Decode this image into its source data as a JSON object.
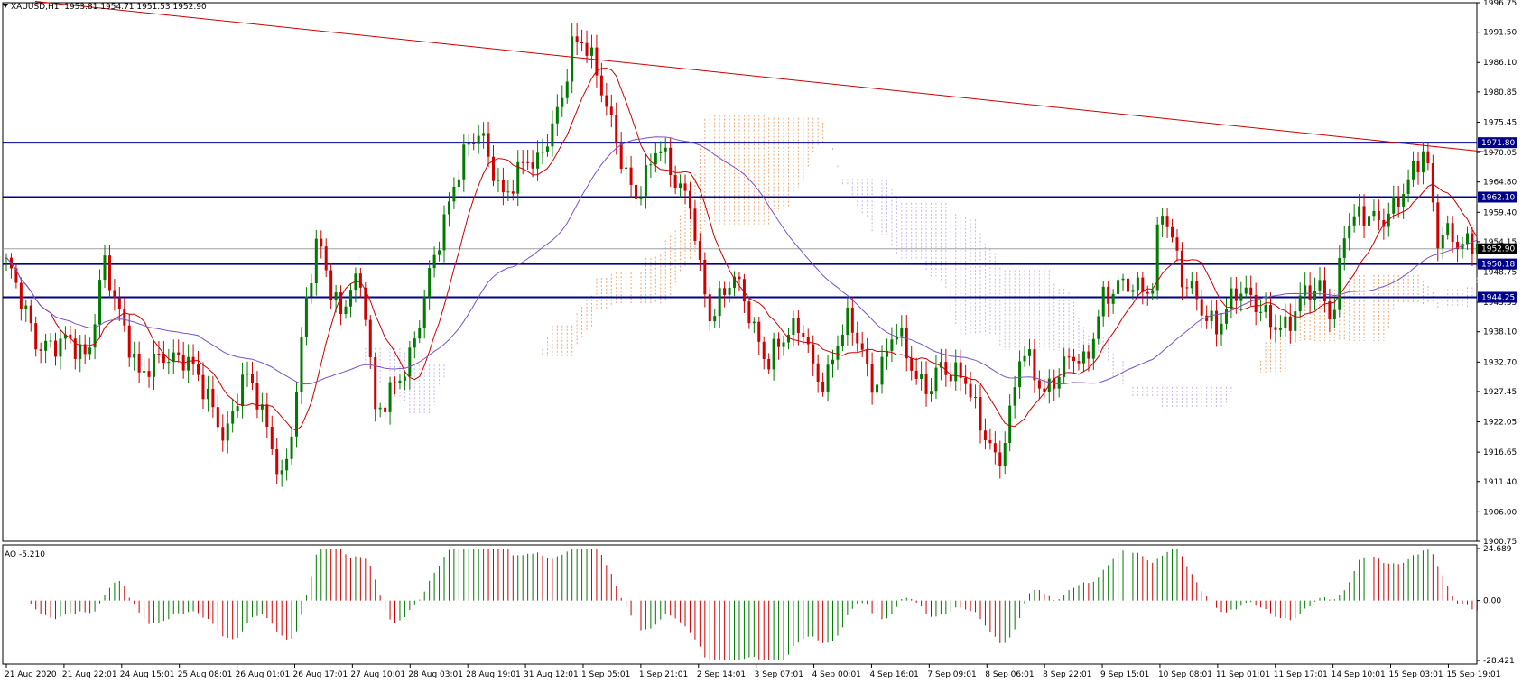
{
  "header": {
    "symbol": "XAUUSD,H1",
    "ohlc": "1953.81 1954.71 1951.53 1952.90",
    "ao_label": "AO -5.210"
  },
  "chart_data": {
    "type": "candlestick",
    "symbol": "XAUUSD",
    "timeframe": "H1",
    "ylim": [
      1900.75,
      1996.75
    ],
    "y_ticks": [
      "1996.75",
      "1991.50",
      "1986.10",
      "1980.85",
      "1975.45",
      "1970.05",
      "1964.80",
      "1959.40",
      "1954.15",
      "1948.75",
      "1943.35",
      "1938.10",
      "1932.70",
      "1927.45",
      "1922.05",
      "1916.65",
      "1911.40",
      "1906.00",
      "1900.75"
    ],
    "x_labels": [
      "21 Aug 2020",
      "21 Aug 22:01",
      "24 Aug 15:01",
      "25 Aug 08:01",
      "26 Aug 01:01",
      "26 Aug 17:01",
      "27 Aug 10:01",
      "28 Aug 03:01",
      "28 Aug 19:01",
      "31 Aug 12:01",
      "1 Sep 05:01",
      "1 Sep 21:01",
      "2 Sep 14:01",
      "3 Sep 07:01",
      "4 Sep 00:01",
      "4 Sep 16:01",
      "7 Sep 09:01",
      "8 Sep 06:01",
      "8 Sep 22:01",
      "9 Sep 15:01",
      "10 Sep 08:01",
      "11 Sep 01:01",
      "11 Sep 17:01",
      "14 Sep 10:01",
      "15 Sep 03:01",
      "15 Sep 19:01"
    ],
    "price_levels": [
      {
        "label": "1971.80",
        "value": 1971.8,
        "color": "#00008b"
      },
      {
        "label": "1962.10",
        "value": 1962.1,
        "color": "#00008b"
      },
      {
        "label": "1950.18",
        "value": 1950.18,
        "color": "#00008b"
      },
      {
        "label": "1944.25",
        "value": 1944.25,
        "color": "#00008b"
      }
    ],
    "current_price": {
      "label": "1952.90",
      "value": 1952.9
    },
    "trendline": {
      "from": [
        0.5,
        1997.0
      ],
      "to": [
        25.8,
        1970.0
      ],
      "color": "#cc0000"
    },
    "close_path": [
      [
        0,
        1950.5
      ],
      [
        0.5,
        1936
      ],
      [
        1,
        1937
      ],
      [
        1.4,
        1932
      ],
      [
        1.7,
        1952
      ],
      [
        2,
        1940
      ],
      [
        2.3,
        1929
      ],
      [
        2.7,
        1935
      ],
      [
        3.1,
        1933
      ],
      [
        3.5,
        1926
      ],
      [
        3.8,
        1920
      ],
      [
        4.1,
        1930
      ],
      [
        4.3,
        1927
      ],
      [
        4.6,
        1918
      ],
      [
        4.8,
        1912
      ],
      [
        5,
        1925
      ],
      [
        5.2,
        1943
      ],
      [
        5.4,
        1954
      ],
      [
        5.6,
        1947
      ],
      [
        5.8,
        1942
      ],
      [
        6,
        1948
      ],
      [
        6.2,
        1944
      ],
      [
        6.4,
        1922
      ],
      [
        6.7,
        1929
      ],
      [
        7,
        1934
      ],
      [
        7.2,
        1941
      ],
      [
        7.4,
        1950
      ],
      [
        7.6,
        1958
      ],
      [
        7.8,
        1967
      ],
      [
        8,
        1972
      ],
      [
        8.2,
        1973
      ],
      [
        8.4,
        1967
      ],
      [
        8.6,
        1962
      ],
      [
        8.8,
        1966
      ],
      [
        9,
        1970
      ],
      [
        9.2,
        1967
      ],
      [
        9.4,
        1972
      ],
      [
        9.6,
        1978
      ],
      [
        9.8,
        1990
      ],
      [
        10,
        1991
      ],
      [
        10.1,
        1988
      ],
      [
        10.3,
        1981
      ],
      [
        10.5,
        1974
      ],
      [
        10.7,
        1968
      ],
      [
        10.9,
        1963
      ],
      [
        11.1,
        1966
      ],
      [
        11.3,
        1971
      ],
      [
        11.5,
        1966
      ],
      [
        11.7,
        1964
      ],
      [
        11.9,
        1961
      ],
      [
        12,
        1951
      ],
      [
        12.2,
        1940
      ],
      [
        12.4,
        1943
      ],
      [
        12.6,
        1948
      ],
      [
        12.8,
        1945
      ],
      [
        13,
        1938
      ],
      [
        13.2,
        1932
      ],
      [
        13.4,
        1935
      ],
      [
        13.6,
        1938
      ],
      [
        13.8,
        1940
      ],
      [
        14,
        1932
      ],
      [
        14.2,
        1928
      ],
      [
        14.4,
        1935
      ],
      [
        14.6,
        1940
      ],
      [
        14.8,
        1937
      ],
      [
        15,
        1929
      ],
      [
        15.2,
        1932
      ],
      [
        15.4,
        1938
      ],
      [
        15.6,
        1934
      ],
      [
        15.8,
        1930
      ],
      [
        16,
        1929
      ],
      [
        16.2,
        1932
      ],
      [
        16.4,
        1929
      ],
      [
        16.6,
        1930
      ],
      [
        16.8,
        1925
      ],
      [
        17,
        1920
      ],
      [
        17.2,
        1914
      ],
      [
        17.4,
        1922
      ],
      [
        17.6,
        1935
      ],
      [
        17.8,
        1932
      ],
      [
        18,
        1928
      ],
      [
        18.2,
        1930
      ],
      [
        18.5,
        1933
      ],
      [
        18.7,
        1932
      ],
      [
        19,
        1945
      ],
      [
        19.3,
        1946
      ],
      [
        19.6,
        1945
      ],
      [
        19.9,
        1947
      ],
      [
        20,
        1963
      ],
      [
        20.2,
        1955
      ],
      [
        20.4,
        1946
      ],
      [
        20.6,
        1944
      ],
      [
        20.8,
        1941
      ],
      [
        21,
        1940
      ],
      [
        21.3,
        1945
      ],
      [
        21.6,
        1943
      ],
      [
        21.9,
        1941
      ],
      [
        22.2,
        1939
      ],
      [
        22.5,
        1944
      ],
      [
        22.8,
        1946
      ],
      [
        23,
        1941
      ],
      [
        23.2,
        1957
      ],
      [
        23.5,
        1958
      ],
      [
        23.8,
        1958
      ],
      [
        24.1,
        1962
      ],
      [
        24.4,
        1966
      ],
      [
        24.6,
        1970
      ],
      [
        24.8,
        1955
      ],
      [
        25,
        1957
      ],
      [
        25.2,
        1954
      ],
      [
        25.4,
        1953
      ],
      [
        25.5,
        1952.9
      ]
    ],
    "indicator": {
      "name": "AO",
      "value": -5.21,
      "ylim": [
        -28.421,
        24.689
      ],
      "y_ticks": [
        "24.689",
        "0.00",
        "-28.421"
      ]
    }
  }
}
